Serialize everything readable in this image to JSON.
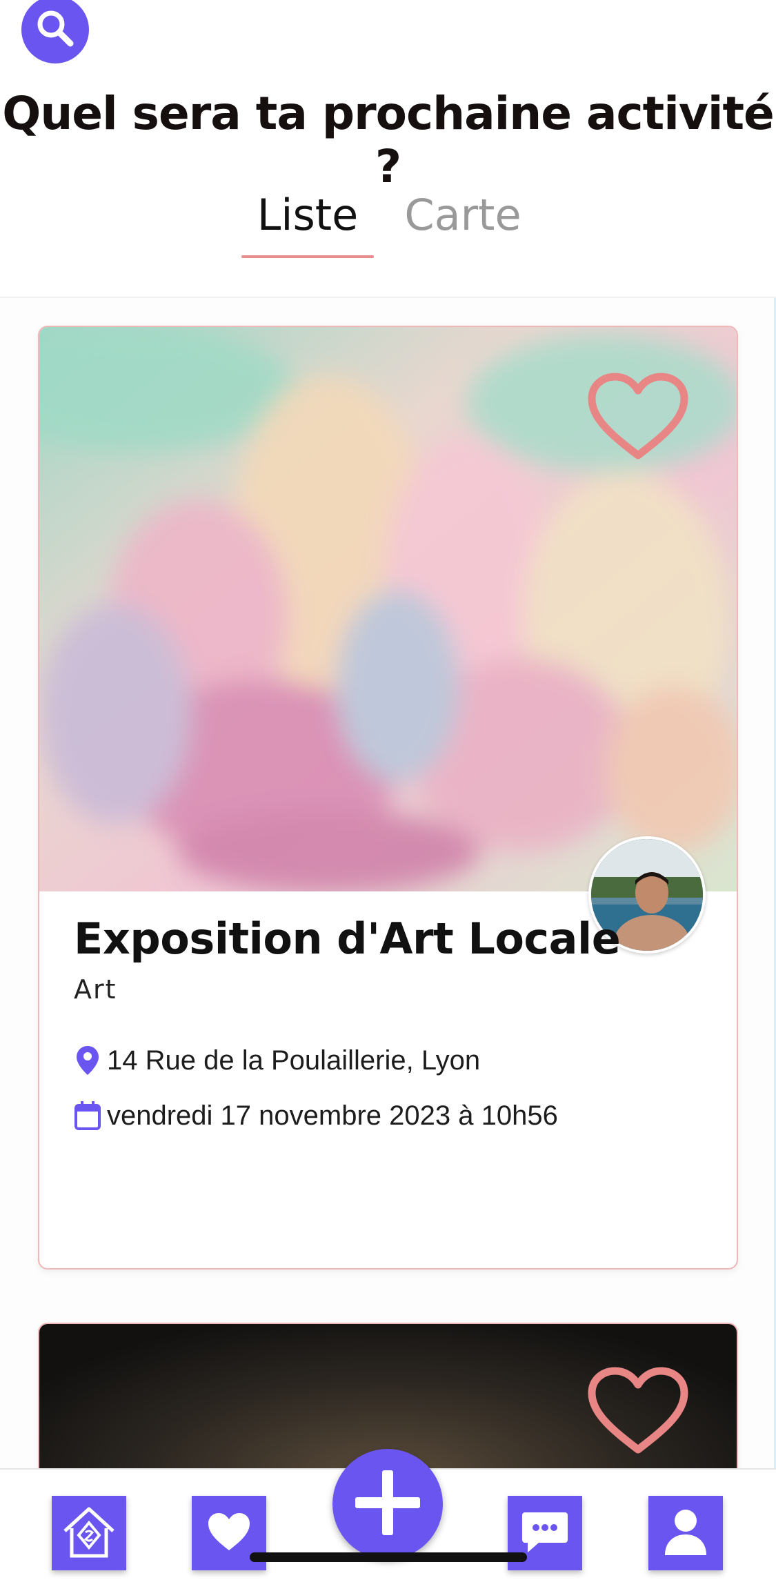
{
  "header": {
    "title": "Quel sera ta prochaine activité ?",
    "search_icon": "search-icon",
    "accent_color": "#6a55f0"
  },
  "tabs": [
    {
      "label": "Liste",
      "active": true
    },
    {
      "label": "Carte",
      "active": false
    }
  ],
  "tab_underline_color": "#e88d8d",
  "activities": [
    {
      "title": "Exposition d'Art Locale",
      "category": "Art",
      "address": "14 Rue de la Poulaillerie, Lyon",
      "datetime": "vendredi 17 novembre 2023 à 10h56",
      "favorite_icon": "heart-outline-icon",
      "location_icon": "map-pin-icon",
      "date_icon": "calendar-icon"
    },
    {
      "favorite_icon": "heart-outline-icon"
    }
  ],
  "bottom_nav": {
    "items": [
      {
        "icon": "home-icon"
      },
      {
        "icon": "heart-icon"
      },
      {
        "icon": "plus-icon"
      },
      {
        "icon": "chat-icon"
      },
      {
        "icon": "user-icon"
      }
    ]
  }
}
